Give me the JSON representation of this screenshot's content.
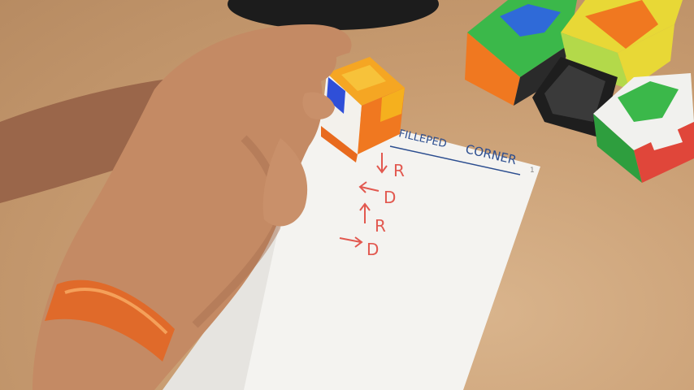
{
  "paper": {
    "heading_left": "FILLEPED",
    "heading_right": "CORNER",
    "corner_mark": "1",
    "moves": [
      {
        "arrow": "down",
        "letter": "R"
      },
      {
        "arrow": "left",
        "letter": "D"
      },
      {
        "arrow": "up",
        "letter": "R"
      },
      {
        "arrow": "right",
        "letter": "D"
      }
    ]
  },
  "colors": {
    "table": "#c79b70",
    "paper": "#f4f3f0",
    "ink_red": "#e2584f",
    "ink_blue": "#2b4d8f",
    "skin": "#b67c5a",
    "bracelet": "#e06a2a"
  },
  "objects": [
    "rubiks-cube-2x2-in-hand",
    "cube-5x5",
    "cube-4x4-yellow",
    "mirror-cube",
    "cube-4x4-green",
    "round-dark-base"
  ]
}
